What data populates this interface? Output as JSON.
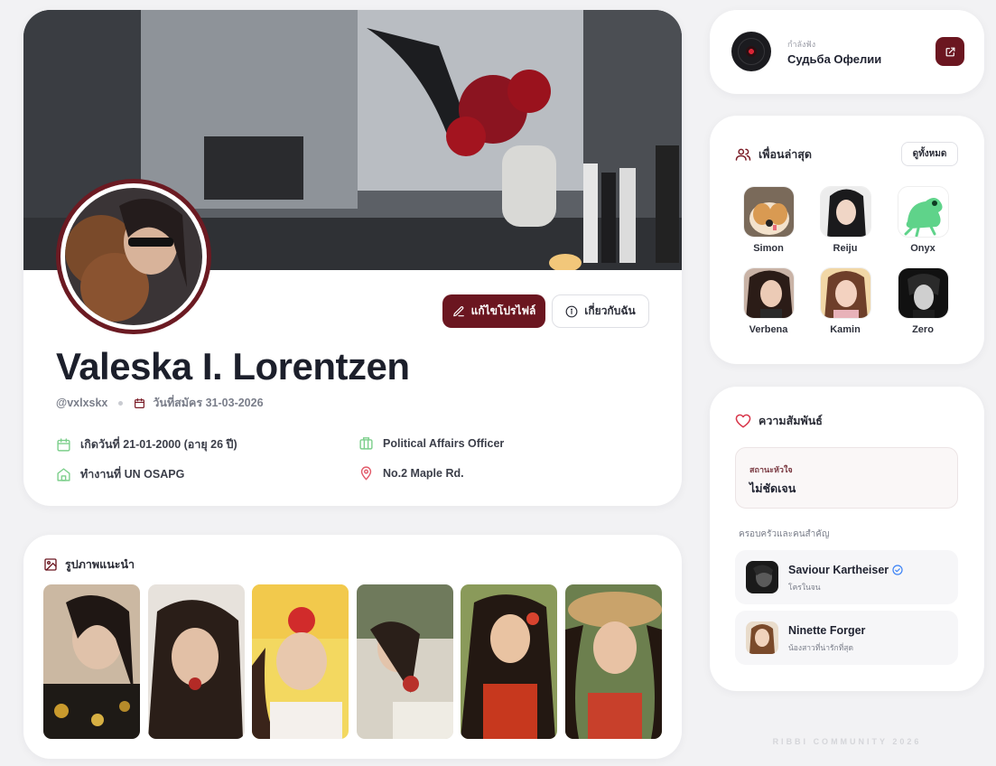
{
  "profile": {
    "name": "Valeska I. Lorentzen",
    "handle": "@vxlxskx",
    "joined": "วันที่สมัคร 31-03-2026",
    "edit_label": "แก้ไขโปรไฟล์",
    "about_label": "เกี่ยวกับฉัน",
    "birthday": "เกิดวันที่ 21-01-2000 (อายุ 26 ปี)",
    "job": "Political Affairs Officer",
    "workplace": "ทำงานที่ UN OSAPG",
    "address": "No.2 Maple Rd."
  },
  "gallery": {
    "title": "รูปภาพแนะนำ"
  },
  "music": {
    "label": "กำลังฟัง",
    "title": "Судьба Офелии"
  },
  "friends": {
    "title": "เพื่อนล่าสุด",
    "see_all": "ดูทั้งหมด",
    "items": [
      {
        "name": "Simon"
      },
      {
        "name": "Reiju"
      },
      {
        "name": "Onyx"
      },
      {
        "name": "Verbena"
      },
      {
        "name": "Kamin"
      },
      {
        "name": "Zero"
      }
    ]
  },
  "relationship": {
    "title": "ความสัมพันธ์",
    "status_label": "สถานะหัวใจ",
    "status_value": "ไม่ชัดเจน",
    "family_label": "ครอบครัวและคนสำคัญ",
    "people": [
      {
        "name": "Saviour Kartheiser",
        "role": "โครในจน"
      },
      {
        "name": "Ninette Forger",
        "role": "น้องสาวที่น่ารักที่สุด"
      }
    ]
  },
  "footer": "RIBBI COMMUNITY 2026",
  "colors": {
    "accent": "#6b1620",
    "background": "#f2f2f4",
    "verified": "#3b82f6"
  }
}
